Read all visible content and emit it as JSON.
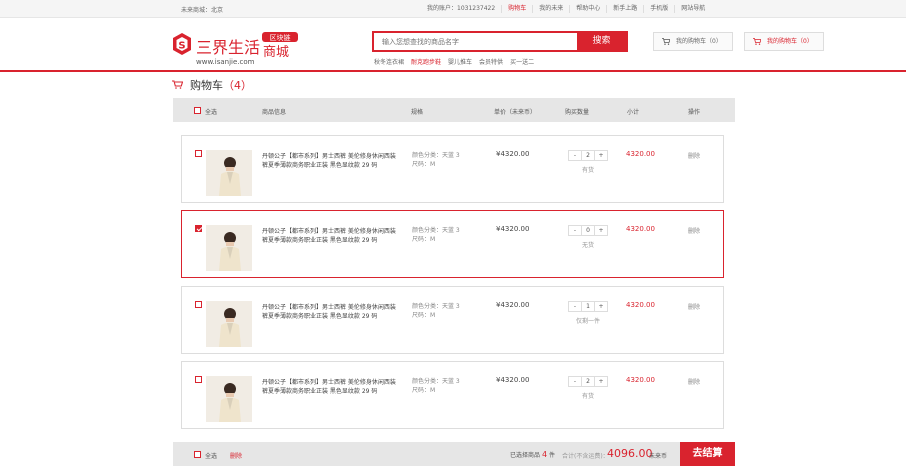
{
  "topbar": {
    "location": "未来商城：北京",
    "links": [
      "我的账户：1031237422",
      "购物车",
      "我的未来",
      "帮助中心",
      "新手上路",
      "手机版",
      "网站导航"
    ],
    "active_index": 1
  },
  "header": {
    "logo_text": "三界生活",
    "logo_badge": "区块链",
    "logo_sub": "商城",
    "logo_url": "www.isanjie.com",
    "search_placeholder": "输入您想查找的商品名字",
    "search_button": "搜索",
    "hotwords": [
      "秋冬连衣裙",
      "耐克跑步鞋",
      "婴儿推车",
      "会员特供",
      "买一送二"
    ],
    "hotword_highlight_index": 1,
    "cart1_label": "我的购物车（0）",
    "cart2_label": "我的购物车（0）"
  },
  "page": {
    "title": "购物车",
    "count": "（4）"
  },
  "table_header": {
    "select_all": "全选",
    "col_info": "商品信息",
    "col_spec": "规格",
    "col_price": "单价（未来币）",
    "col_qty": "购买数量",
    "col_subtotal": "小计",
    "col_action": "操作"
  },
  "items": [
    {
      "title": "丹顿公子【都市系列】男士西裤 美伦修身休闲西装裤夏季薄款商务职业正装 黑色显纹款 29 码",
      "spec_color": "颜色分类：天蓝 3",
      "spec_size": "尺码：M",
      "price": "¥4320.00",
      "qty": "2",
      "stock": "有货",
      "subtotal": "4320.00",
      "action": "删除",
      "checked": false
    },
    {
      "title": "丹顿公子【都市系列】男士西裤 美伦修身休闲西装裤夏季薄款商务职业正装 黑色显纹款 29 码",
      "spec_color": "颜色分类：天蓝 3",
      "spec_size": "尺码：M",
      "price": "¥4320.00",
      "qty": "0",
      "stock": "无货",
      "subtotal": "4320.00",
      "action": "删除",
      "checked": true
    },
    {
      "title": "丹顿公子【都市系列】男士西裤 美伦修身休闲西装裤夏季薄款商务职业正装 黑色显纹款 29 码",
      "spec_color": "颜色分类：天蓝 3",
      "spec_size": "尺码：M",
      "price": "¥4320.00",
      "qty": "1",
      "stock": "仅剩一件",
      "subtotal": "4320.00",
      "action": "删除",
      "checked": false
    },
    {
      "title": "丹顿公子【都市系列】男士西裤 美伦修身休闲西装裤夏季薄款商务职业正装 黑色显纹款 29 码",
      "spec_color": "颜色分类：天蓝 3",
      "spec_size": "尺码：M",
      "price": "¥4320.00",
      "qty": "2",
      "stock": "有货",
      "subtotal": "4320.00",
      "action": "删除",
      "checked": false
    }
  ],
  "stepper": {
    "minus": "-",
    "plus": "+"
  },
  "footer": {
    "select_all": "全选",
    "delete": "删除",
    "selected_prefix": "已选择商品",
    "selected_count": "4",
    "selected_suffix": "件",
    "total_label": "合计(不含运费)：",
    "amount": "4096.00",
    "unit": "未来币",
    "checkout": "去结算"
  },
  "colors": {
    "accent": "#d9232e"
  }
}
